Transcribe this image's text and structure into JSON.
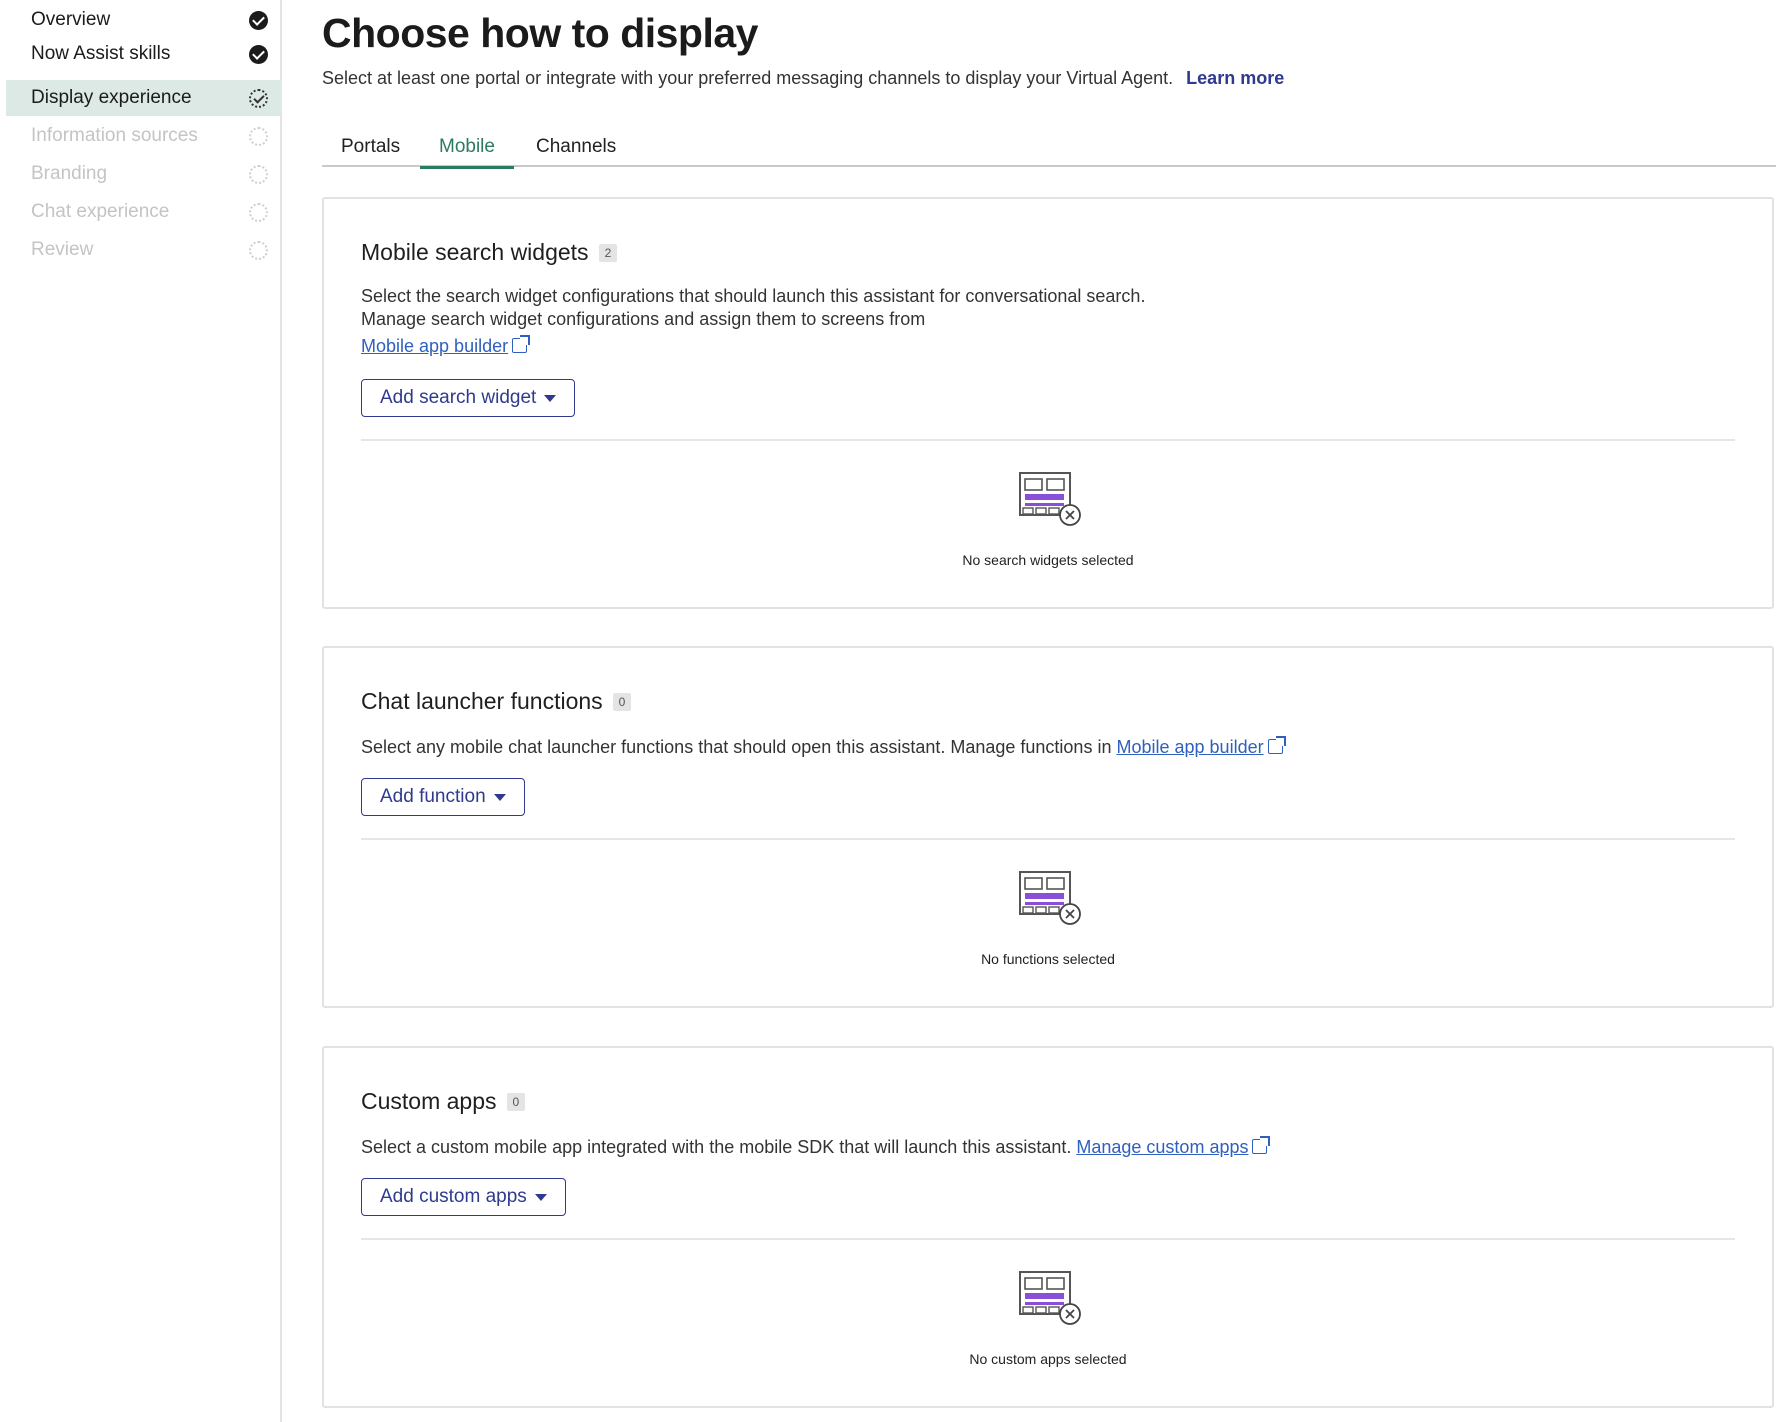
{
  "sidebar": {
    "items": [
      {
        "label": "Overview",
        "state": "done"
      },
      {
        "label": "Now Assist skills",
        "state": "done"
      },
      {
        "label": "Display experience",
        "state": "in-progress"
      },
      {
        "label": "Information sources",
        "state": "pending"
      },
      {
        "label": "Branding",
        "state": "pending"
      },
      {
        "label": "Chat experience",
        "state": "pending"
      },
      {
        "label": "Review",
        "state": "pending"
      }
    ]
  },
  "header": {
    "title": "Choose how to display",
    "subtitle": "Select at least one portal or integrate with your preferred messaging channels to display your Virtual Agent.",
    "learn_more": "Learn more"
  },
  "tabs": [
    {
      "label": "Portals"
    },
    {
      "label": "Mobile",
      "active": true
    },
    {
      "label": "Channels"
    }
  ],
  "cards": {
    "search_widgets": {
      "title": "Mobile search widgets",
      "count": "2",
      "desc_line1": "Select the search widget configurations that should launch this assistant for conversational search.",
      "desc_line2": "Manage search widget configurations and assign them to screens from",
      "link": "Mobile app builder",
      "button": "Add search widget",
      "empty": "No search widgets selected"
    },
    "chat_launcher": {
      "title": "Chat launcher functions",
      "count": "0",
      "desc": "Select any mobile chat launcher functions that should open this assistant. Manage functions in",
      "link": "Mobile app builder",
      "button": "Add function",
      "empty": "No functions selected"
    },
    "custom_apps": {
      "title": "Custom apps",
      "count": "0",
      "desc": "Select a custom mobile app integrated with the mobile SDK that will launch this assistant.",
      "link": "Manage custom apps",
      "button": "Add custom apps",
      "empty": "No custom apps selected"
    }
  },
  "colors": {
    "accent_green": "#2c7a5f",
    "button_blue": "#2f3a8f",
    "link_blue": "#2f5fbf",
    "active_nav_bg": "#dde9e4",
    "empty_icon_purple": "#8a4fd8"
  },
  "icons": [
    "check-circle-icon",
    "progress-circle-icon",
    "pending-circle-icon",
    "external-link-icon",
    "caret-down-icon",
    "empty-state-icon"
  ]
}
